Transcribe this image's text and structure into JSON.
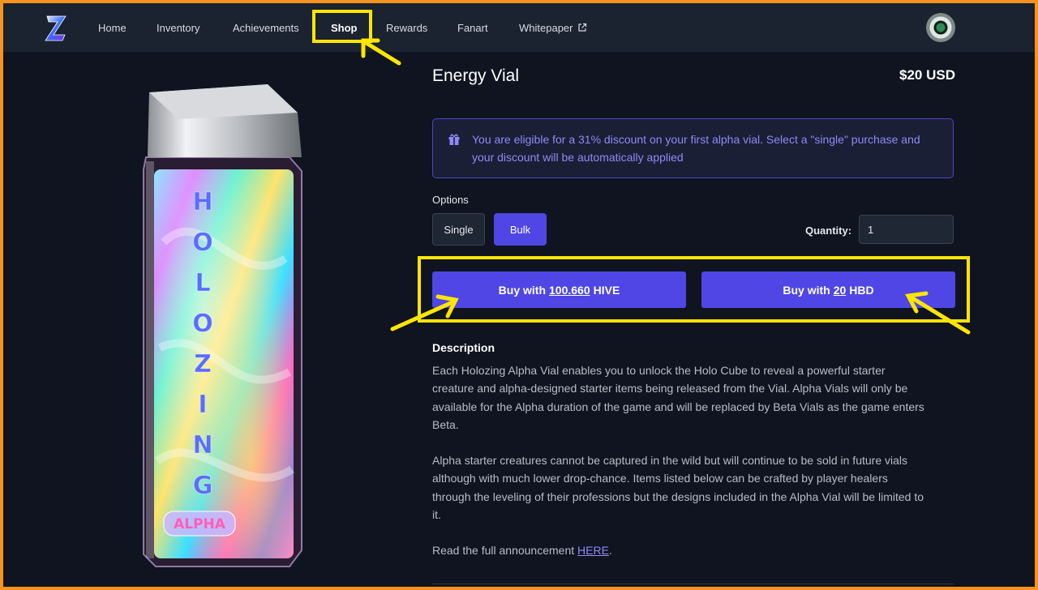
{
  "nav": {
    "items": [
      {
        "label": "Home"
      },
      {
        "label": "Inventory"
      },
      {
        "label": "Achievements"
      },
      {
        "label": "Shop"
      },
      {
        "label": "Rewards"
      },
      {
        "label": "Fanart"
      },
      {
        "label": "Whitepaper"
      }
    ],
    "active": "Shop",
    "logo_icon": "holozing-z-logo",
    "external_icon": "external-link-icon"
  },
  "product": {
    "title": "Energy Vial",
    "price": "$20 USD",
    "vial_text": "HOLOZING",
    "vial_badge": "ALPHA"
  },
  "notice": {
    "icon": "gift-icon",
    "text": "You are eligible for a 31% discount on your first alpha vial. Select a \"single\" purchase and your discount will be automatically applied"
  },
  "options": {
    "label": "Options",
    "single": "Single",
    "bulk": "Bulk",
    "selected": "Bulk",
    "quantity_label": "Quantity:",
    "quantity_value": "1"
  },
  "buy": {
    "hive": {
      "prefix": "Buy with",
      "amount": "100.660",
      "currency": "HIVE"
    },
    "hbd": {
      "prefix": "Buy with",
      "amount": "20",
      "currency": "HBD"
    }
  },
  "description": {
    "heading": "Description",
    "p1": "Each Holozing Alpha Vial enables you to unlock the Holo Cube to reveal a powerful starter creature and alpha-designed starter items being released from the Vial. Alpha Vials will only be available for the Alpha duration of the game and will be replaced by Beta Vials as the game enters Beta.",
    "p2": "Alpha starter creatures cannot be captured in the wild but will continue to be sold in future vials although with much lower drop-chance. Items listed below can be crafted by player healers through the leveling of their professions but the designs included in the Alpha Vial will be limited to it.",
    "p3_prefix": "Read the full announcement",
    "p3_link": "HERE",
    "p3_suffix": "."
  },
  "colors": {
    "accent": "#4f46e5",
    "annotation": "#ffe600",
    "frame": "#f7931e",
    "background": "#0f1420"
  }
}
